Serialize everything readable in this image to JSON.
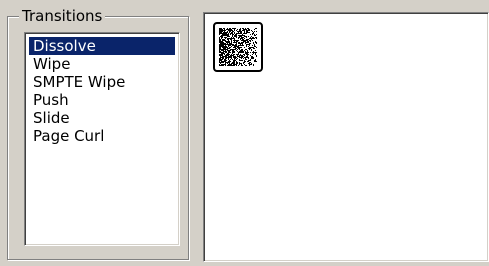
{
  "transitions_group": {
    "legend": "Transitions",
    "items": [
      {
        "label": "Dissolve",
        "selected": true
      },
      {
        "label": "Wipe",
        "selected": false
      },
      {
        "label": "SMPTE Wipe",
        "selected": false
      },
      {
        "label": "Push",
        "selected": false
      },
      {
        "label": "Slide",
        "selected": false
      },
      {
        "label": "Page Curl",
        "selected": false
      }
    ]
  },
  "preview": {
    "thumbnail_icon": "dissolve-noise-icon"
  },
  "colors": {
    "face": "#d4d0c8",
    "selection_background": "#0a246a",
    "selection_text": "#ffffff",
    "list_background": "#ffffff"
  }
}
